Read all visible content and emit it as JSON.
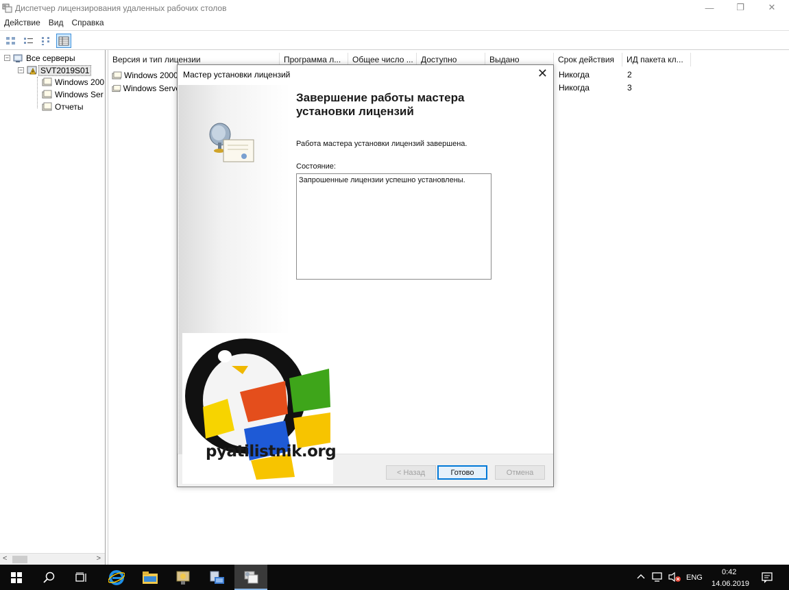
{
  "window": {
    "title": "Диспетчер лицензирования удаленных рабочих столов",
    "minimize": "—",
    "restore": "❐",
    "close": "✕"
  },
  "menu": [
    "Действие",
    "Вид",
    "Справка"
  ],
  "toolbar": {
    "buttons": [
      "large-icons",
      "small-icons",
      "list",
      "details"
    ],
    "active": "details"
  },
  "tree": {
    "root": "Все серверы",
    "server": "SVT2019S01",
    "children": [
      "Windows 200",
      "Windows Ser",
      "Отчеты"
    ],
    "scroll_left": "<",
    "scroll_right": ">"
  },
  "list": {
    "columns": [
      "Версия и тип лицензии",
      "Программа л...",
      "Общее число ...",
      "Доступно",
      "Выдано",
      "Срок действия",
      "ИД пакета кл..."
    ],
    "rows": [
      {
        "name": "Windows 2000",
        "expiry": "Никогда",
        "id": "2"
      },
      {
        "name": "Windows Serve",
        "expiry": "Никогда",
        "id": "3"
      }
    ]
  },
  "dialog": {
    "title": "Мастер установки лицензий",
    "close": "✕",
    "heading_line1": "Завершение работы мастера",
    "heading_line2": "установки лицензий",
    "text": "Работа мастера установки лицензий завершена.",
    "status_label": "Состояние:",
    "status_value": "Запрошенные лицензии успешно установлены.",
    "btn_back": "< Назад",
    "btn_finish": "Готово",
    "btn_cancel": "Отмена"
  },
  "watermark": {
    "text": "pyatilistnik.org"
  },
  "taskbar": {
    "lang": "ENG",
    "time": "0:42",
    "date": "14.06.2019",
    "accent": "#0078d7"
  }
}
